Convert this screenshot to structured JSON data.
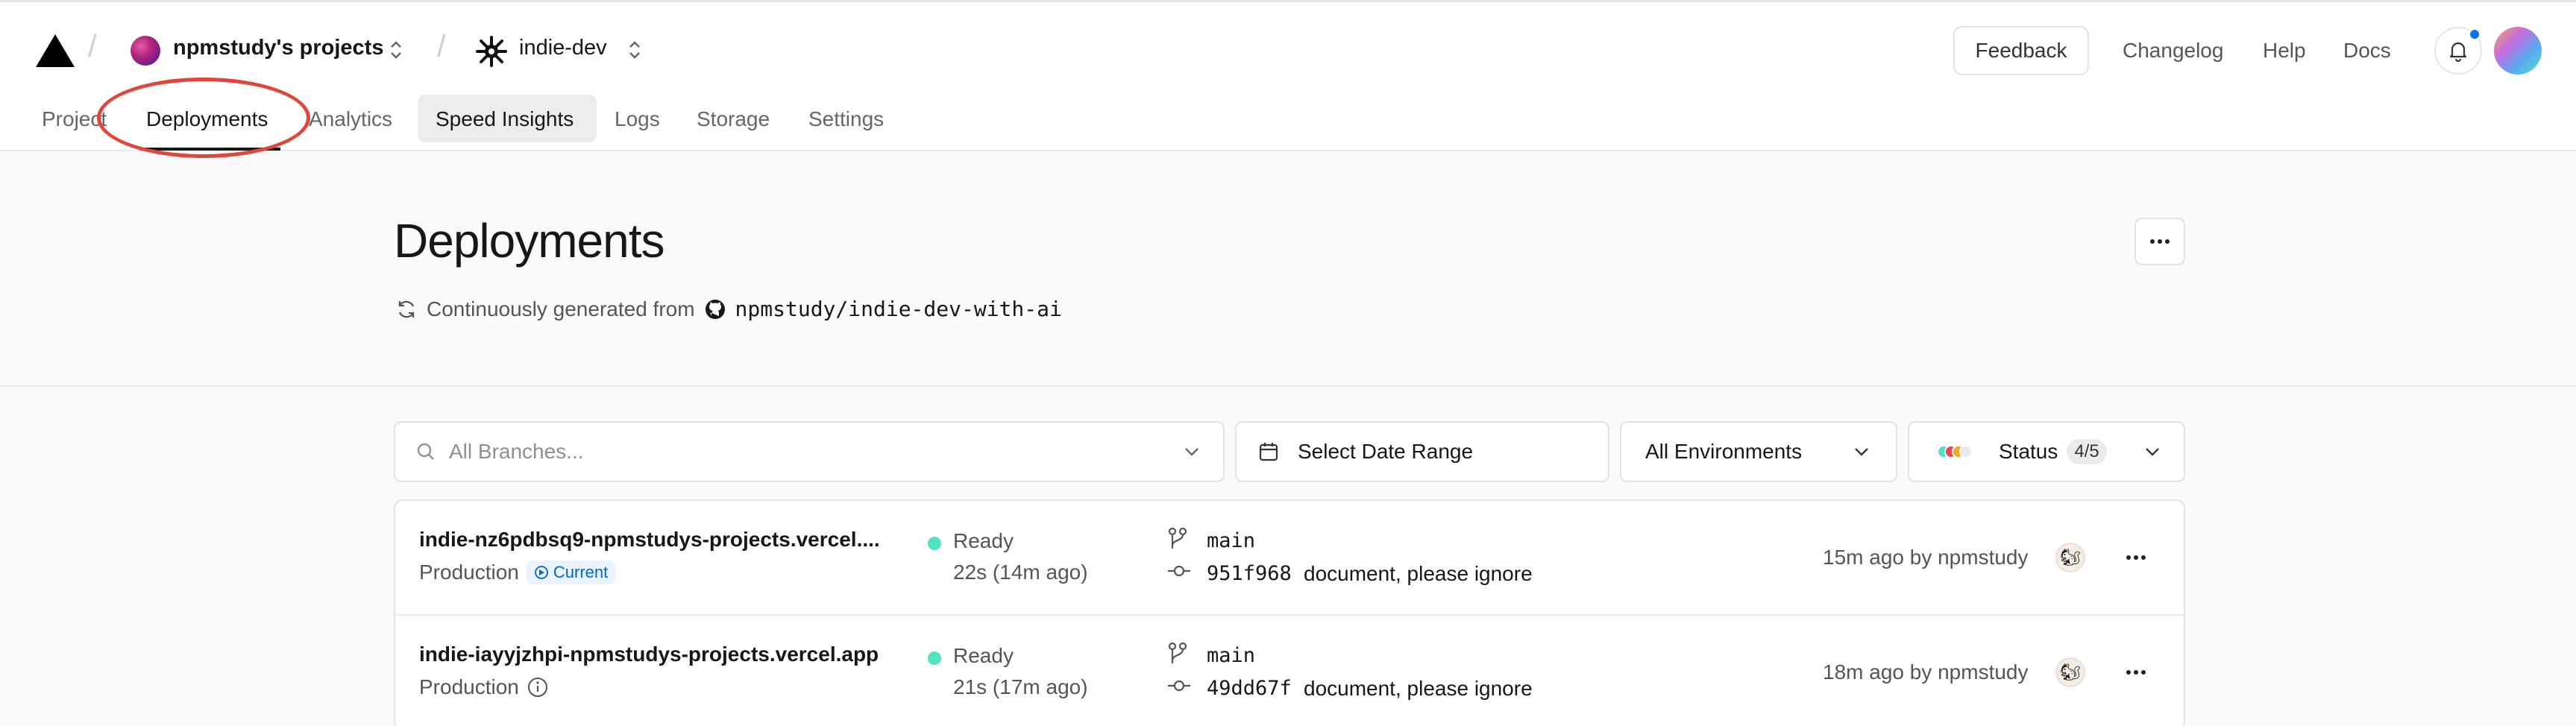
{
  "header": {
    "team_name": "npmstudy's projects",
    "project_name": "indie-dev",
    "feedback_label": "Feedback",
    "links": [
      "Changelog",
      "Help",
      "Docs"
    ]
  },
  "tabs": [
    "Project",
    "Deployments",
    "Analytics",
    "Speed Insights",
    "Logs",
    "Storage",
    "Settings"
  ],
  "page": {
    "title": "Deployments",
    "subtitle_prefix": "Continuously generated from",
    "repo": "npmstudy/indie-dev-with-ai"
  },
  "filters": {
    "branches_placeholder": "All Branches...",
    "date_label": "Select Date Range",
    "environments_label": "All Environments",
    "status_label": "Status",
    "status_count": "4/5"
  },
  "deployments": [
    {
      "url": "indie-nz6pdbsq9-npmstudys-projects.vercel....",
      "environment": "Production",
      "badge": "Current",
      "status": "Ready",
      "duration": "22s (14m ago)",
      "branch": "main",
      "commit_hash": "951f968",
      "commit_message": "document, please ignore",
      "created": "15m ago by npmstudy"
    },
    {
      "url": "indie-iayyjzhpi-npmstudys-projects.vercel.app",
      "environment": "Production",
      "status": "Ready",
      "duration": "21s (17m ago)",
      "branch": "main",
      "commit_hash": "49dd67f",
      "commit_message": "document, please ignore",
      "created": "18m ago by npmstudy"
    }
  ],
  "colors": {
    "ready": "#50e3c2",
    "annotation": "#e0463a",
    "current_badge": "#0068d6",
    "notification_dot": "#0a72ef"
  }
}
